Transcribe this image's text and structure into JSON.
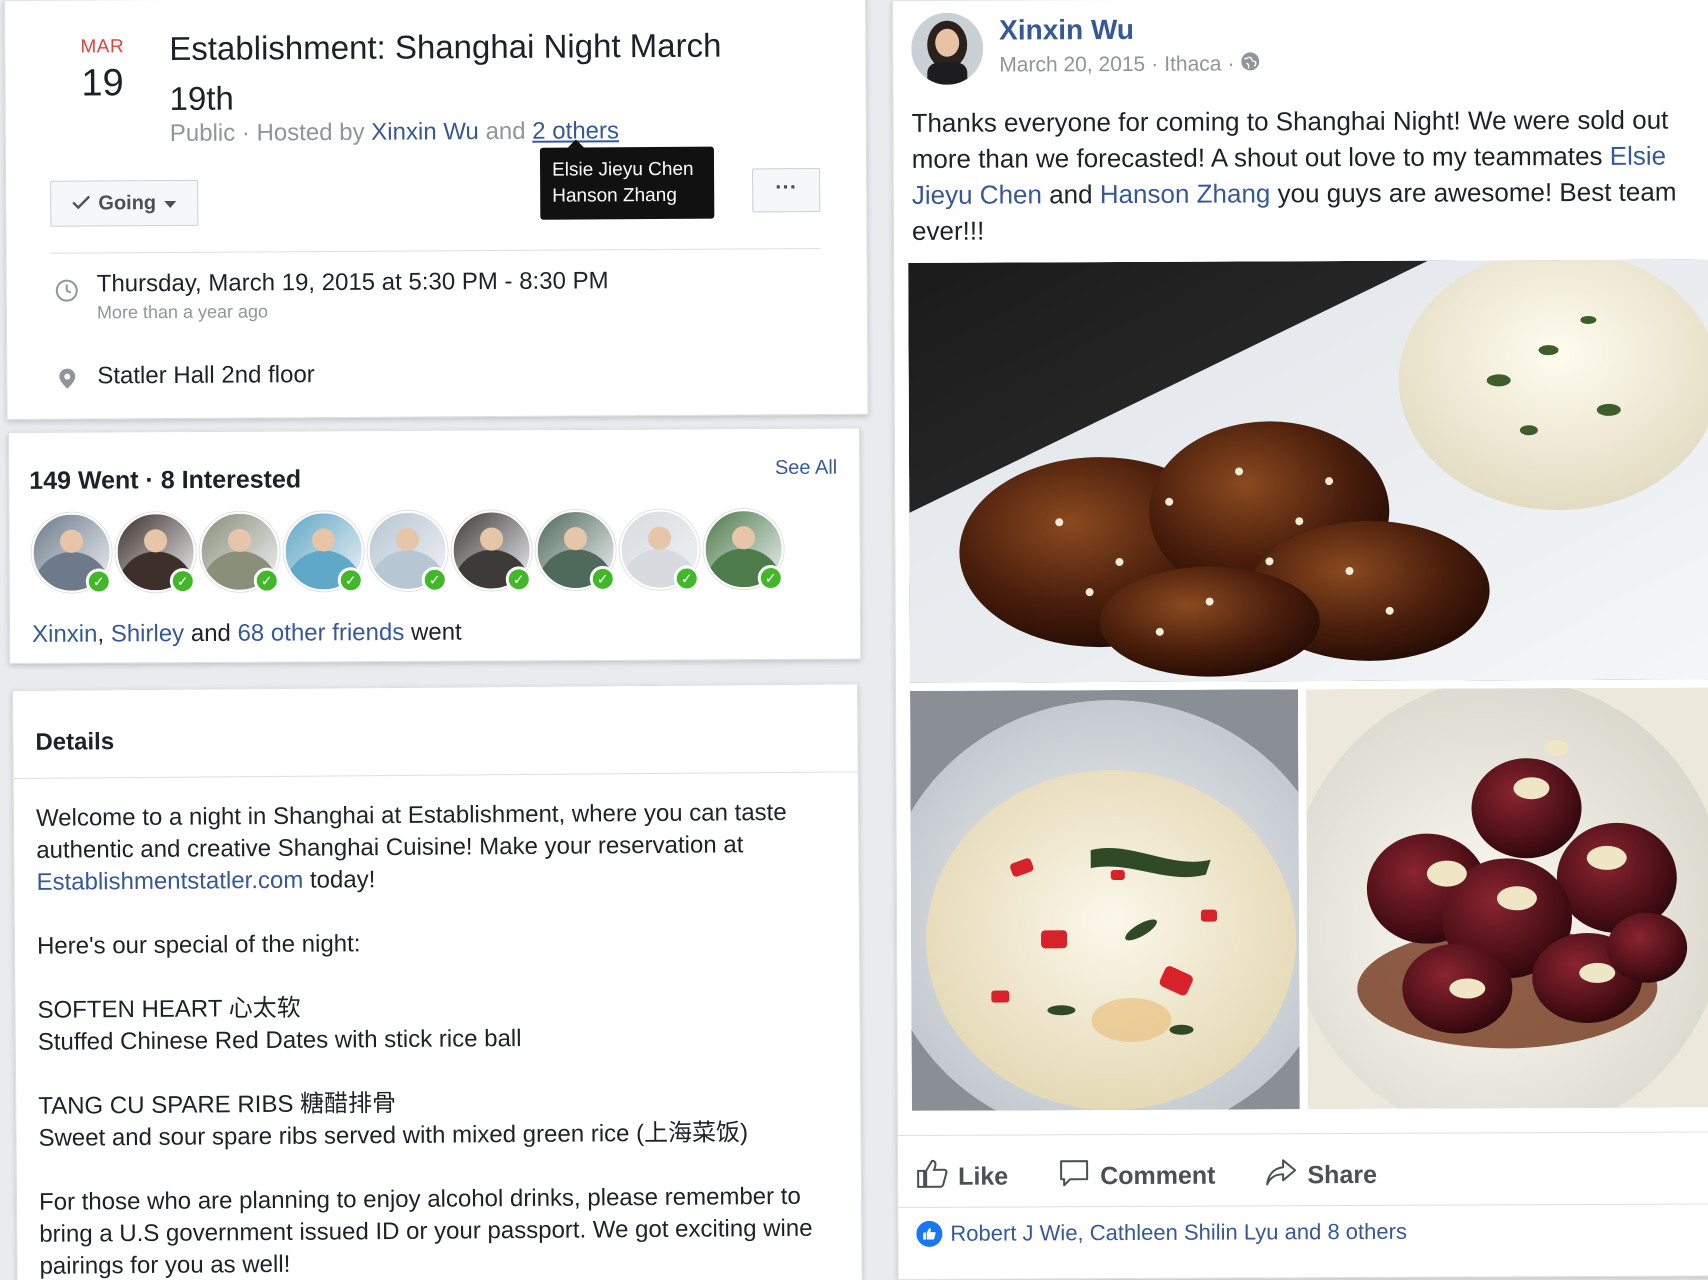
{
  "event": {
    "date_month": "MAR",
    "date_day": "19",
    "title": "Establishment: Shanghai Night March 19th",
    "privacy": "Public",
    "hosted_by_prefix": "· Hosted by",
    "host_name": "Xinxin Wu",
    "and_text": "and",
    "others_link": "2 others",
    "tooltip_names": [
      "Elsie Jieyu Chen",
      "Hanson Zhang"
    ],
    "going_label": "Going",
    "more_label": "···",
    "datetime": "Thursday, March 19, 2015 at 5:30 PM - 8:30 PM",
    "relative_time": "More than a year ago",
    "location": "Statler Hall 2nd floor"
  },
  "went": {
    "went_count": "149 Went",
    "separator": "·",
    "interested_count": "8 Interested",
    "see_all": "See All",
    "avatar_colors": [
      "#6c7a8a",
      "#3d2f2a",
      "#8a8f7a",
      "#5fa8c7",
      "#b7c6d3",
      "#3e3a38",
      "#4f6a5a",
      "#d7dbe0",
      "#4e7b4a"
    ],
    "friend_1": "Xinxin",
    "comma": ",",
    "friend_2": "Shirley",
    "and_text": "and",
    "others_friends": "68 other friends",
    "went_word": "went"
  },
  "details": {
    "title": "Details",
    "intro_part1": "Welcome to a night in Shanghai at Establishment, where you can taste authentic and creative Shanghai Cuisine! Make your reservation at",
    "intro_link": "Establishmentstatler.com",
    "intro_part2": "today!",
    "special_heading": "Here's our special of the night:",
    "dish1_name": "SOFTEN HEART 心太软",
    "dish1_desc": "Stuffed Chinese Red Dates with stick rice ball",
    "dish2_name": "TANG CU SPARE RIBS 糖醋排骨",
    "dish2_desc": "Sweet and sour spare ribs served with mixed green rice (上海菜饭)",
    "alcohol_note": "For those who are planning to enjoy alcohol drinks, please remember to bring a U.S government issued ID or your passport. We got exciting wine pairings for you as well!"
  },
  "post": {
    "author": "Xinxin Wu",
    "date": "March 20, 2015",
    "location": "Ithaca",
    "meta_sep": "·",
    "text_part1": "Thanks everyone for coming to Shanghai Night! We were sold out more than we forecasted! A shout out love to my teammates",
    "mention_1": "Elsie Jieyu Chen",
    "text_and": "and",
    "mention_2": "Hanson Zhang",
    "text_part2": "you guys are awesome! Best team ever!!!",
    "actions": {
      "like": "Like",
      "comment": "Comment",
      "share": "Share"
    },
    "reactions_text": "Robert J Wie, Cathleen Shilin Lyu and 8 others"
  },
  "colors": {
    "link": "#365899",
    "date_red": "#e0423a",
    "check_green": "#42b72a",
    "like_blue": "#1877f2"
  }
}
